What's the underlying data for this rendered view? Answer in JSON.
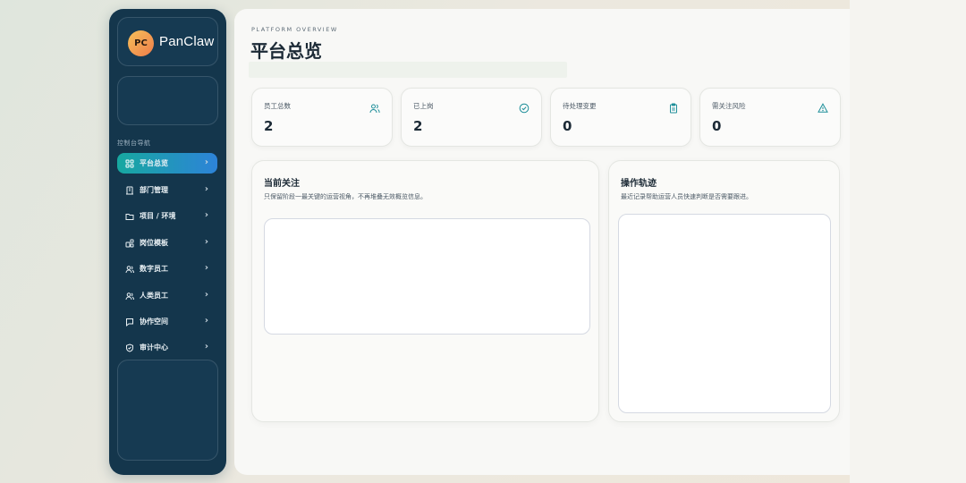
{
  "brand": {
    "logo_text": "PC",
    "name": "PanClaw"
  },
  "nav": {
    "heading": "控制台导航",
    "items": [
      {
        "label": "平台总览",
        "icon": "grid-icon",
        "active": true
      },
      {
        "label": "部门管理",
        "icon": "building-icon",
        "active": false
      },
      {
        "label": "项目 / 环境",
        "icon": "folder-icon",
        "active": false
      },
      {
        "label": "岗位模板",
        "icon": "template-icon",
        "active": false
      },
      {
        "label": "数字员工",
        "icon": "users-icon",
        "active": false
      },
      {
        "label": "人类员工",
        "icon": "users-icon",
        "active": false
      },
      {
        "label": "协作空间",
        "icon": "chat-icon",
        "active": false
      },
      {
        "label": "审计中心",
        "icon": "shield-icon",
        "active": false
      }
    ]
  },
  "header": {
    "overline": "PLATFORM OVERVIEW",
    "title": "平台总览"
  },
  "stats": [
    {
      "label": "员工总数",
      "value": "2",
      "icon": "users-icon"
    },
    {
      "label": "已上岗",
      "value": "2",
      "icon": "check-circle-icon"
    },
    {
      "label": "待处理变更",
      "value": "0",
      "icon": "clipboard-icon"
    },
    {
      "label": "需关注风险",
      "value": "0",
      "icon": "warning-icon"
    }
  ],
  "focus_panel": {
    "title": "当前关注",
    "subtitle": "只保留阶段一最关键的运营视角，不再堆叠无效概览信息。"
  },
  "trail_panel": {
    "title": "操作轨迹",
    "subtitle": "最近记录帮助运营人员快速判断是否需要跟进。"
  },
  "colors": {
    "sidebar": "#14364c",
    "accent_start": "#17a8a0",
    "accent_end": "#2d83d8",
    "icon_teal": "#1f8f9a"
  }
}
